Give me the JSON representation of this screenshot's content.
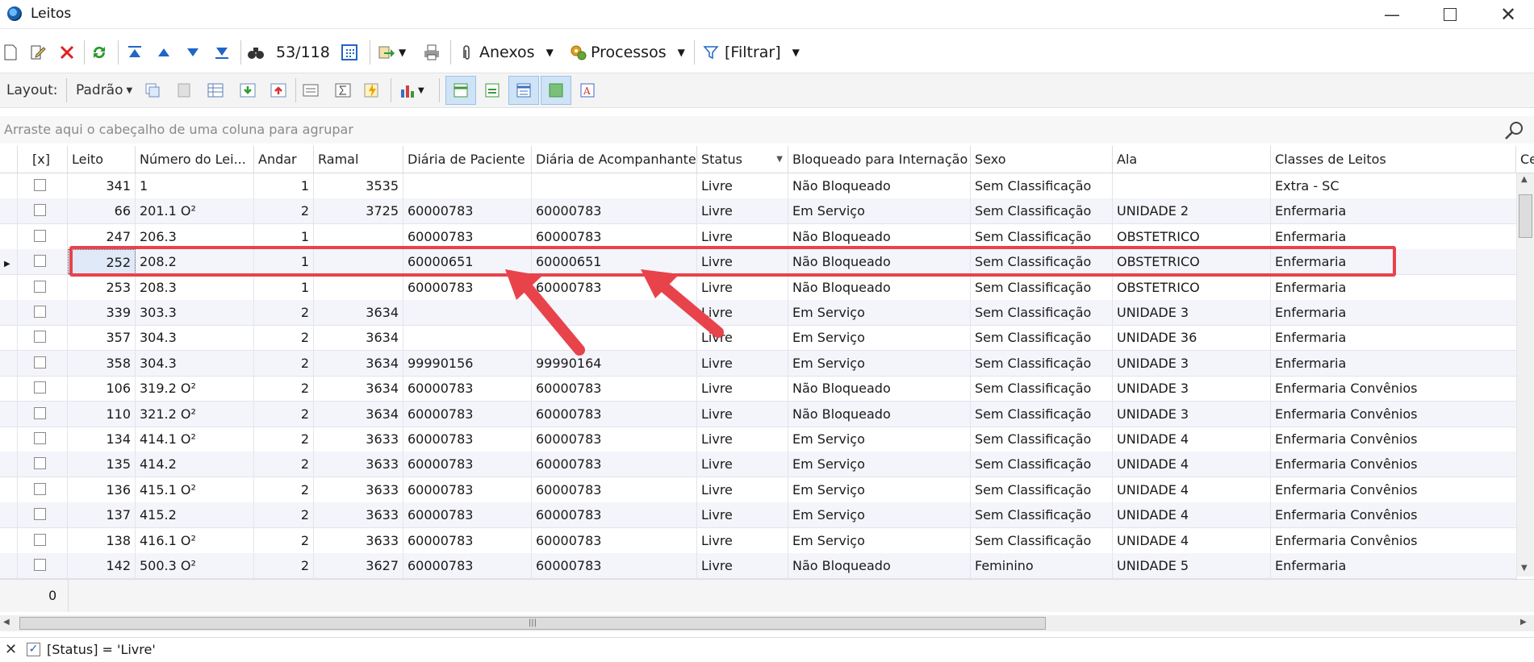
{
  "window": {
    "title": "Leitos"
  },
  "toolbar": {
    "record_count": "53/118",
    "attachments_label": "Anexos",
    "processes_label": "Processos",
    "filter_label": "[Filtrar]"
  },
  "layout_bar": {
    "label": "Layout:",
    "preset": "Padrão"
  },
  "group_hint": "Arraste aqui o cabeçalho de uma coluna para agrupar",
  "columns": {
    "check": "[x]",
    "leito": "Leito",
    "numero": "Número do Lei...",
    "andar": "Andar",
    "ramal": "Ramal",
    "diaria_paciente": "Diária de Paciente",
    "diaria_acomp": "Diária de Acompanhante",
    "status": "Status",
    "bloqueado": "Bloqueado para Internação",
    "sexo": "Sexo",
    "ala": "Ala",
    "classes": "Classes de Leitos",
    "extra": "Ce"
  },
  "rows": [
    {
      "leito": "341",
      "numero": "1",
      "andar": "1",
      "ramal": "3535",
      "dp": "",
      "da": "",
      "status": "Livre",
      "bloq": "Não Bloqueado",
      "sexo": "Sem Classificação",
      "ala": "",
      "classe": "Extra - SC"
    },
    {
      "leito": "66",
      "numero": "201.1 O²",
      "andar": "2",
      "ramal": "3725",
      "dp": "60000783",
      "da": "60000783",
      "status": "Livre",
      "bloq": "Em Serviço",
      "sexo": "Sem Classificação",
      "ala": "UNIDADE 2",
      "classe": "Enfermaria"
    },
    {
      "leito": "247",
      "numero": "206.3",
      "andar": "1",
      "ramal": "",
      "dp": "60000783",
      "da": "60000783",
      "status": "Livre",
      "bloq": "Não Bloqueado",
      "sexo": "Sem Classificação",
      "ala": "OBSTETRICO",
      "classe": "Enfermaria"
    },
    {
      "leito": "252",
      "numero": "208.2",
      "andar": "1",
      "ramal": "",
      "dp": "60000651",
      "da": "60000651",
      "status": "Livre",
      "bloq": "Não Bloqueado",
      "sexo": "Sem Classificação",
      "ala": "OBSTETRICO",
      "classe": "Enfermaria"
    },
    {
      "leito": "253",
      "numero": "208.3",
      "andar": "1",
      "ramal": "",
      "dp": "60000783",
      "da": "60000783",
      "status": "Livre",
      "bloq": "Não Bloqueado",
      "sexo": "Sem Classificação",
      "ala": "OBSTETRICO",
      "classe": "Enfermaria"
    },
    {
      "leito": "339",
      "numero": "303.3",
      "andar": "2",
      "ramal": "3634",
      "dp": "",
      "da": "",
      "status": "Livre",
      "bloq": "Em Serviço",
      "sexo": "Sem Classificação",
      "ala": "UNIDADE 3",
      "classe": "Enfermaria"
    },
    {
      "leito": "357",
      "numero": "304.3",
      "andar": "2",
      "ramal": "3634",
      "dp": "",
      "da": "",
      "status": "Livre",
      "bloq": "Em Serviço",
      "sexo": "Sem Classificação",
      "ala": "UNIDADE 36",
      "classe": "Enfermaria"
    },
    {
      "leito": "358",
      "numero": "304.3",
      "andar": "2",
      "ramal": "3634",
      "dp": "99990156",
      "da": "99990164",
      "status": "Livre",
      "bloq": "Em Serviço",
      "sexo": "Sem Classificação",
      "ala": "UNIDADE 3",
      "classe": "Enfermaria"
    },
    {
      "leito": "106",
      "numero": "319.2 O²",
      "andar": "2",
      "ramal": "3634",
      "dp": "60000783",
      "da": "60000783",
      "status": "Livre",
      "bloq": "Não Bloqueado",
      "sexo": "Sem Classificação",
      "ala": "UNIDADE 3",
      "classe": "Enfermaria Convênios"
    },
    {
      "leito": "110",
      "numero": "321.2 O²",
      "andar": "2",
      "ramal": "3634",
      "dp": "60000783",
      "da": "60000783",
      "status": "Livre",
      "bloq": "Não Bloqueado",
      "sexo": "Sem Classificação",
      "ala": "UNIDADE 3",
      "classe": "Enfermaria Convênios"
    },
    {
      "leito": "134",
      "numero": "414.1 O²",
      "andar": "2",
      "ramal": "3633",
      "dp": "60000783",
      "da": "60000783",
      "status": "Livre",
      "bloq": "Em Serviço",
      "sexo": "Sem Classificação",
      "ala": "UNIDADE 4",
      "classe": "Enfermaria Convênios"
    },
    {
      "leito": "135",
      "numero": "414.2",
      "andar": "2",
      "ramal": "3633",
      "dp": "60000783",
      "da": "60000783",
      "status": "Livre",
      "bloq": "Em Serviço",
      "sexo": "Sem Classificação",
      "ala": "UNIDADE 4",
      "classe": "Enfermaria Convênios"
    },
    {
      "leito": "136",
      "numero": "415.1 O²",
      "andar": "2",
      "ramal": "3633",
      "dp": "60000783",
      "da": "60000783",
      "status": "Livre",
      "bloq": "Em Serviço",
      "sexo": "Sem Classificação",
      "ala": "UNIDADE 4",
      "classe": "Enfermaria Convênios"
    },
    {
      "leito": "137",
      "numero": "415.2",
      "andar": "2",
      "ramal": "3633",
      "dp": "60000783",
      "da": "60000783",
      "status": "Livre",
      "bloq": "Em Serviço",
      "sexo": "Sem Classificação",
      "ala": "UNIDADE 4",
      "classe": "Enfermaria Convênios"
    },
    {
      "leito": "138",
      "numero": "416.1 O²",
      "andar": "2",
      "ramal": "3633",
      "dp": "60000783",
      "da": "60000783",
      "status": "Livre",
      "bloq": "Em Serviço",
      "sexo": "Sem Classificação",
      "ala": "UNIDADE 4",
      "classe": "Enfermaria Convênios"
    },
    {
      "leito": "142",
      "numero": "500.3 O²",
      "andar": "2",
      "ramal": "3627",
      "dp": "60000783",
      "da": "60000783",
      "status": "Livre",
      "bloq": "Não Bloqueado",
      "sexo": "Feminino",
      "ala": "UNIDADE 5",
      "classe": "Enfermaria"
    }
  ],
  "selected_row_index": 3,
  "footer": {
    "checked_count": "0"
  },
  "filter": {
    "expression": "[Status] = 'Livre'"
  },
  "colors": {
    "highlight": "#e8434b",
    "row_alt": "#f4f4fb"
  }
}
